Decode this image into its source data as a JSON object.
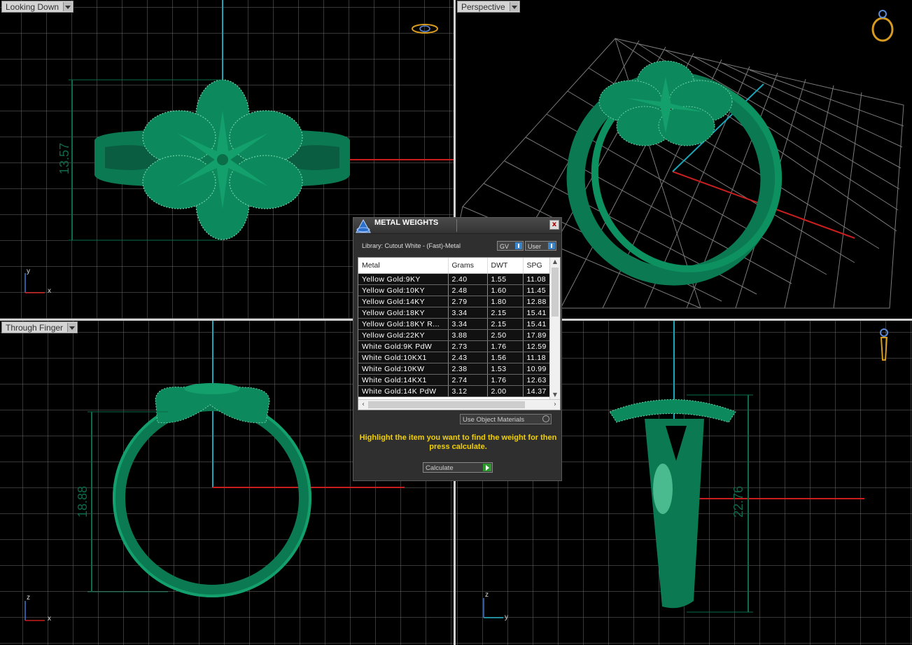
{
  "viewports": {
    "top_left": {
      "label": "Looking Down",
      "dimension": "13.57",
      "axis_v": "y",
      "axis_h": "x"
    },
    "top_right": {
      "label": "Perspective"
    },
    "bottom_left": {
      "label": "Through Finger",
      "dimension": "18.88",
      "axis_v": "z",
      "axis_h": "x"
    },
    "bottom_right": {
      "dimension": "22.76",
      "axis_v": "z",
      "axis_h": "y"
    }
  },
  "dialog": {
    "title": "METAL WEIGHTS",
    "close_label": "x",
    "library_label": "Library: Cutout White - (Fast)-Metal",
    "gv_button": "GV",
    "user_button": "User",
    "columns": [
      "Metal",
      "Grams",
      "DWT",
      "SPG"
    ],
    "rows": [
      [
        "Yellow Gold:9KY",
        "2.40",
        "1.55",
        "11.08"
      ],
      [
        "Yellow Gold:10KY",
        "2.48",
        "1.60",
        "11.45"
      ],
      [
        "Yellow Gold:14KY",
        "2.79",
        "1.80",
        "12.88"
      ],
      [
        "Yellow Gold:18KY",
        "3.34",
        "2.15",
        "15.41"
      ],
      [
        "Yellow Gold:18KY R...",
        "3.34",
        "2.15",
        "15.41"
      ],
      [
        "Yellow Gold:22KY",
        "3.88",
        "2.50",
        "17.89"
      ],
      [
        "White Gold:9K PdW",
        "2.73",
        "1.76",
        "12.59"
      ],
      [
        "White Gold:10KX1",
        "2.43",
        "1.56",
        "11.18"
      ],
      [
        "White Gold:10KW",
        "2.38",
        "1.53",
        "10.99"
      ],
      [
        "White Gold:14KX1",
        "2.74",
        "1.76",
        "12.63"
      ],
      [
        "White Gold:14K PdW",
        "3.12",
        "2.00",
        "14.37"
      ]
    ],
    "materials_select": "Use Object Materials",
    "hint": "Highlight the item you want to find the weight for then press calculate.",
    "calculate_button": "Calculate"
  }
}
